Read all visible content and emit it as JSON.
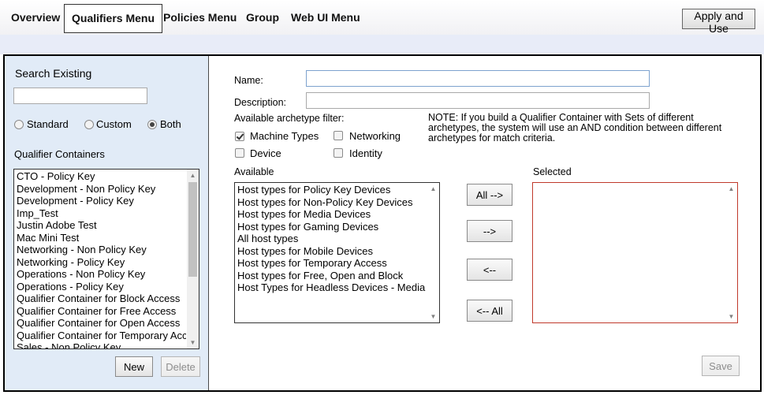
{
  "nav": {
    "tabs": [
      {
        "label": "Overview"
      },
      {
        "label": "Qualifiers Menu"
      },
      {
        "label": "Policies Menu"
      },
      {
        "label": "Group"
      },
      {
        "label": "Web UI Menu"
      }
    ],
    "active_tab": "Qualifiers Menu",
    "apply_label": "Apply and Use"
  },
  "left_panel": {
    "search_label": "Search Existing",
    "search_value": "",
    "filter_options": [
      {
        "label": "Standard",
        "checked": false
      },
      {
        "label": "Custom",
        "checked": false
      },
      {
        "label": "Both",
        "checked": true
      }
    ],
    "containers_label": "Qualifier Containers",
    "containers": [
      "CTO - Policy Key",
      "Development - Non Policy Key",
      "Development - Policy Key",
      "Imp_Test",
      "Justin Adobe Test",
      "Mac Mini Test",
      "Networking - Non Policy Key",
      "Networking - Policy Key",
      "Operations - Non Policy Key",
      "Operations - Policy Key",
      "Qualifier Container for Block Access",
      "Qualifier Container for Free Access",
      "Qualifier Container for Open Access",
      "Qualifier Container for Temporary Access",
      "Sales - Non Policy Key"
    ],
    "new_label": "New",
    "delete_label": "Delete"
  },
  "right_panel": {
    "name_label": "Name:",
    "name_value": "",
    "description_label": "Description:",
    "description_value": "",
    "archetype_label": "Available archetype filter:",
    "archetypes": [
      {
        "label": "Machine Types",
        "checked": true
      },
      {
        "label": "Networking",
        "checked": false
      },
      {
        "label": "Device",
        "checked": false
      },
      {
        "label": "Identity",
        "checked": false
      }
    ],
    "note": "NOTE: If you build a Qualifier Container with Sets of different archetypes, the system will use an AND condition between different archetypes for match criteria.",
    "available_label": "Available",
    "available_items": [
      "Host types for Policy Key Devices",
      "Host types for Non-Policy Key Devices",
      "Host types for Media Devices",
      "Host types for Gaming Devices",
      "All host types",
      "Host types for Mobile Devices",
      "Host types for Temporary Access",
      "Host types for Free, Open and Block",
      "Host Types for Headless Devices - Media"
    ],
    "selected_label": "Selected",
    "selected_items": [],
    "move_all_right_label": "All -->",
    "move_right_label": "-->",
    "move_left_label": "<--",
    "move_all_left_label": "<-- All",
    "save_label": "Save"
  }
}
